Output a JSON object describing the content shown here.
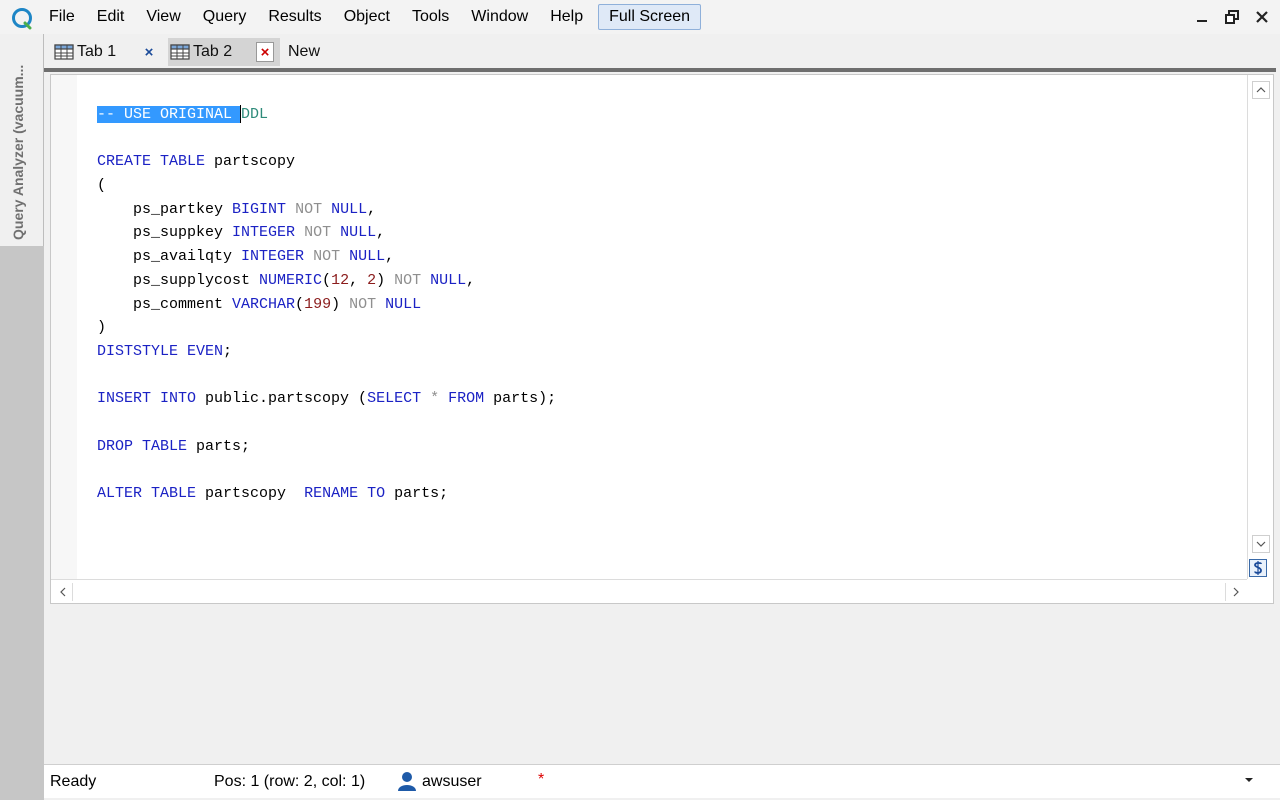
{
  "menu": {
    "items": [
      "File",
      "Edit",
      "View",
      "Query",
      "Results",
      "Object",
      "Tools",
      "Window",
      "Help"
    ],
    "full_screen": "Full Screen"
  },
  "side_panel": {
    "label": "Query Analyzer (vacuum..."
  },
  "tabs": [
    {
      "label": "Tab 1",
      "close": "×"
    },
    {
      "label": "Tab 2",
      "close": "×"
    },
    {
      "label": "New"
    }
  ],
  "editor": {
    "selected_text": "-- USE ORIGINAL ",
    "comment_rest": "DDL"
  },
  "status": {
    "ready": "Ready",
    "position": "Pos: 1 (row: 2, col: 1)",
    "user": "awsuser",
    "modified": "*"
  },
  "colors": {
    "keyword": "#1b22c4",
    "muted_keyword": "#8f8f8f",
    "number": "#8b1c1c",
    "comment": "#2e8b7a",
    "selection": "#3399ff"
  },
  "icons": {
    "app": "app-logo-icon",
    "tab": "table-grid-icon",
    "user": "user-icon",
    "scroll_lock": "scroll-sync-icon"
  }
}
